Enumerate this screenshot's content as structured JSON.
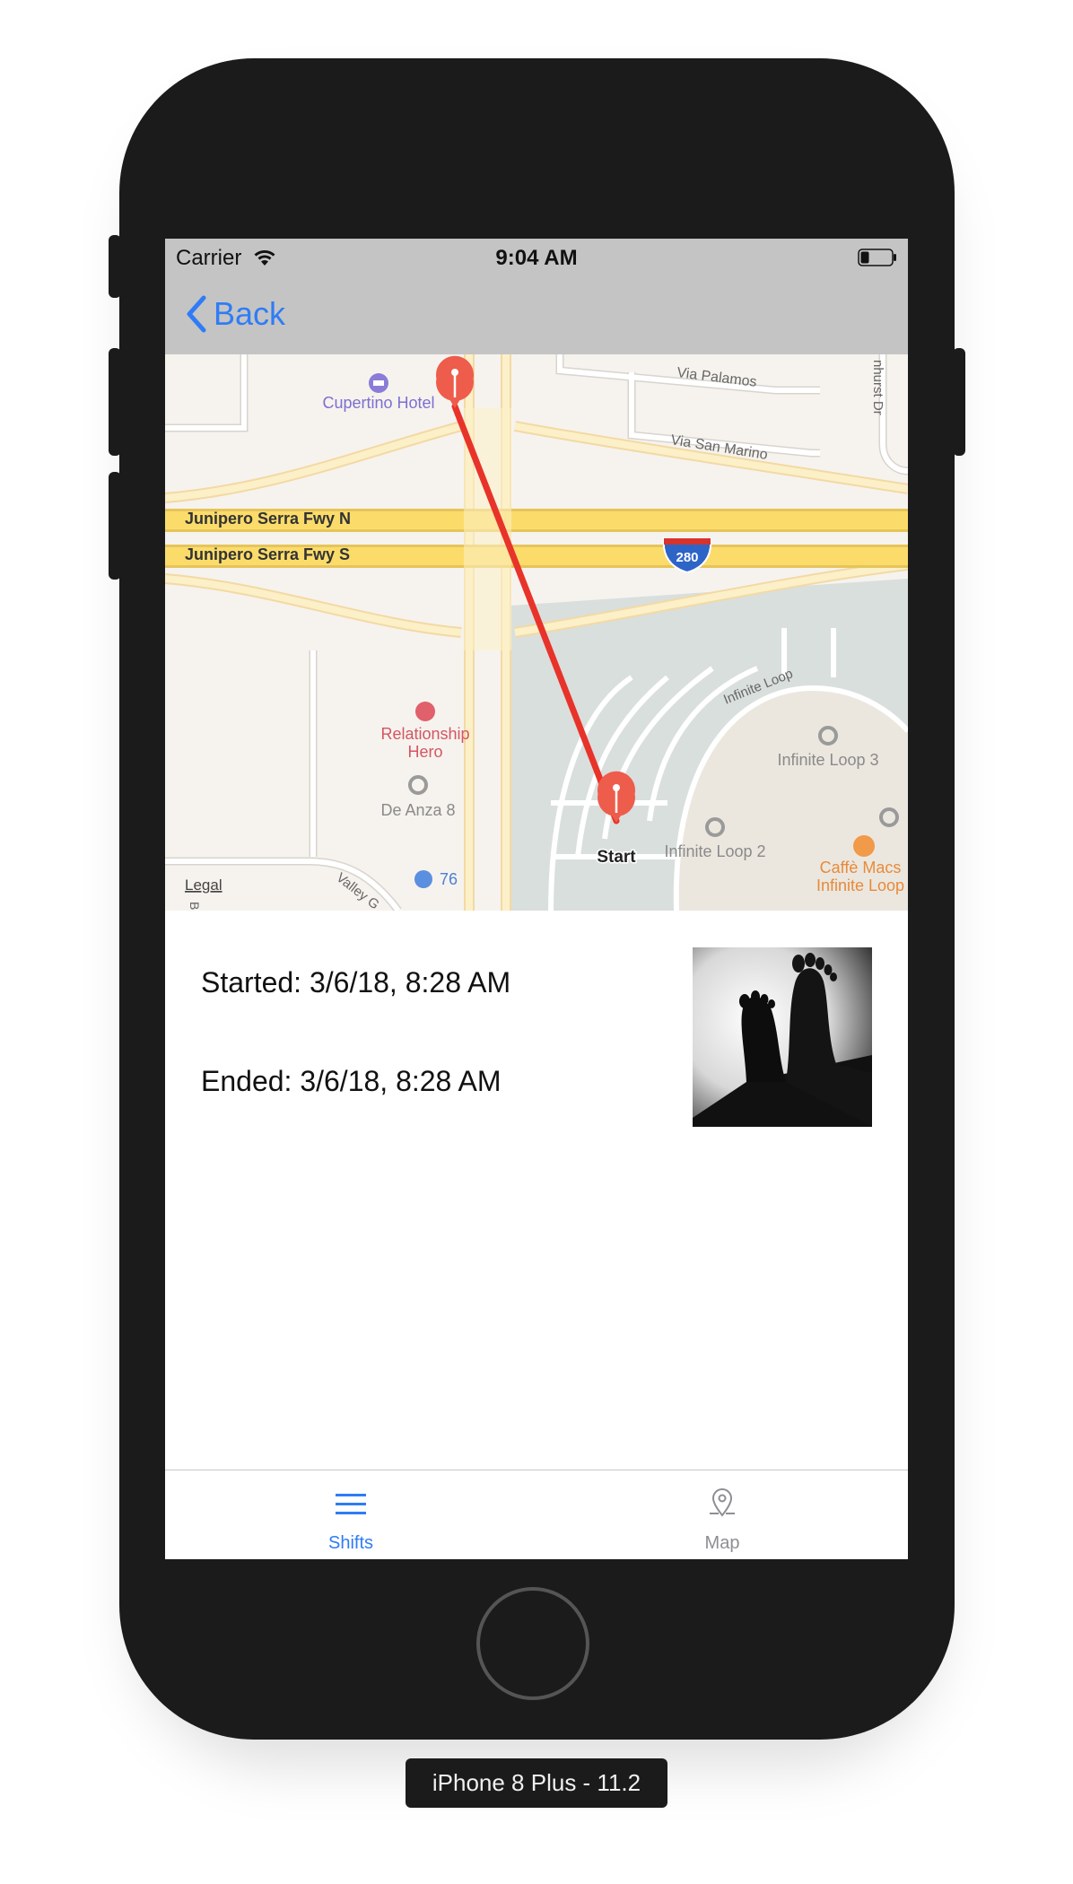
{
  "status_bar": {
    "carrier": "Carrier",
    "time": "9:04 AM"
  },
  "nav": {
    "back_label": "Back"
  },
  "map": {
    "labels": {
      "cupertino_hotel": "Cupertino Hotel",
      "via_palamos": "Via Palamos",
      "via_san_marino": "Via San Marino",
      "amhurst": "nhurst Dr",
      "fwy_n": "Junipero Serra Fwy N",
      "fwy_s": "Junipero Serra Fwy S",
      "interstate": "280",
      "infinite_loop_road": "Infinite Loop",
      "relationship_hero_1": "Relationship",
      "relationship_hero_2": "Hero",
      "infinite_loop_3": "Infinite Loop 3",
      "de_anza_8": "De Anza 8",
      "infinite_loop_2": "Infinite Loop 2",
      "caffe_macs_1": "Caffè Macs",
      "caffe_macs_2": "Infinite Loop",
      "start": "Start",
      "legal": "Legal",
      "gas_76": "76",
      "valley": "Valley G",
      "ba": "Ba"
    },
    "route_color": "#e8332a",
    "pin_color": "#ee5c4b"
  },
  "details": {
    "started": "Started: 3/6/18, 8:28 AM",
    "ended": "Ended: 3/6/18, 8:28 AM"
  },
  "tabs": [
    {
      "label": "Shifts",
      "icon": "list-icon",
      "selected": true
    },
    {
      "label": "Map",
      "icon": "map-pin-icon",
      "selected": false
    }
  ],
  "colors": {
    "accent": "#2f7cf6",
    "inactive": "#8e8e93"
  },
  "simulator_label": "iPhone 8 Plus - 11.2"
}
